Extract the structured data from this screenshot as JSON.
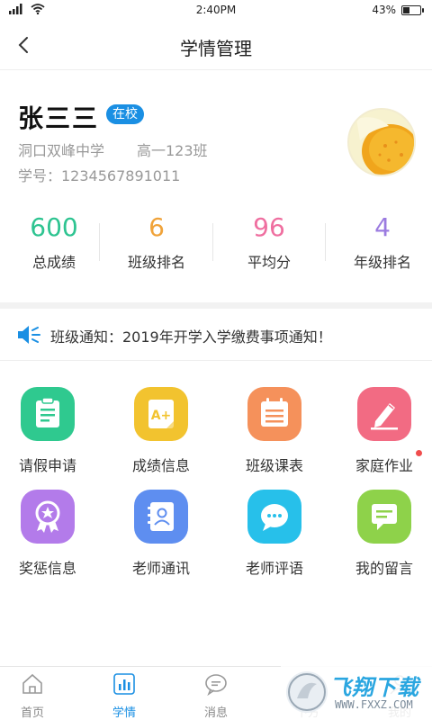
{
  "status_bar": {
    "time": "2:40PM",
    "battery": "43%",
    "battery_level": 0.43
  },
  "nav": {
    "title": "学情管理"
  },
  "student": {
    "name": "张三三",
    "status": "在校",
    "school": "洞口双峰中学",
    "class": "高一123班",
    "student_no": "学号：1234567891011"
  },
  "stats": [
    {
      "value": "600",
      "label": "总成绩",
      "color": "#2ec491"
    },
    {
      "value": "6",
      "label": "班级排名",
      "color": "#f0a33a"
    },
    {
      "value": "96",
      "label": "平均分",
      "color": "#ef6fa0"
    },
    {
      "value": "4",
      "label": "年级排名",
      "color": "#9b7be0"
    }
  ],
  "notice": {
    "text": "班级通知：2019年开学入学缴费事项通知！"
  },
  "grid": [
    {
      "label": "请假申请",
      "icon": "clipboard-icon",
      "color": "#2fc98f"
    },
    {
      "label": "成绩信息",
      "icon": "grade-a-plus-icon",
      "color": "#f2c32f"
    },
    {
      "label": "班级课表",
      "icon": "calendar-icon",
      "color": "#f5915b"
    },
    {
      "label": "家庭作业",
      "icon": "pencil-icon",
      "color": "#f26b83"
    },
    {
      "label": "奖惩信息",
      "icon": "award-icon",
      "color": "#b37bea"
    },
    {
      "label": "老师通讯",
      "icon": "contacts-book-icon",
      "color": "#5e8ef0"
    },
    {
      "label": "老师评语",
      "icon": "chat-bubble-icon",
      "color": "#27c0ea"
    },
    {
      "label": "我的留言",
      "icon": "message-icon",
      "color": "#8ed24a"
    }
  ],
  "tabs": [
    {
      "label": "首页",
      "icon": "home-icon"
    },
    {
      "label": "学情",
      "icon": "bar-chart-icon"
    },
    {
      "label": "消息",
      "icon": "speech-bubble-icon"
    },
    {
      "label": "下方",
      "icon": "tab-icon"
    },
    {
      "label": "我的",
      "icon": "user-icon"
    }
  ],
  "colors": {
    "accent": "#1a8fe3",
    "badge": "#1a8fe3"
  },
  "watermark": {
    "title": "飞翔下载",
    "url": "WWW.FXXZ.COM"
  }
}
